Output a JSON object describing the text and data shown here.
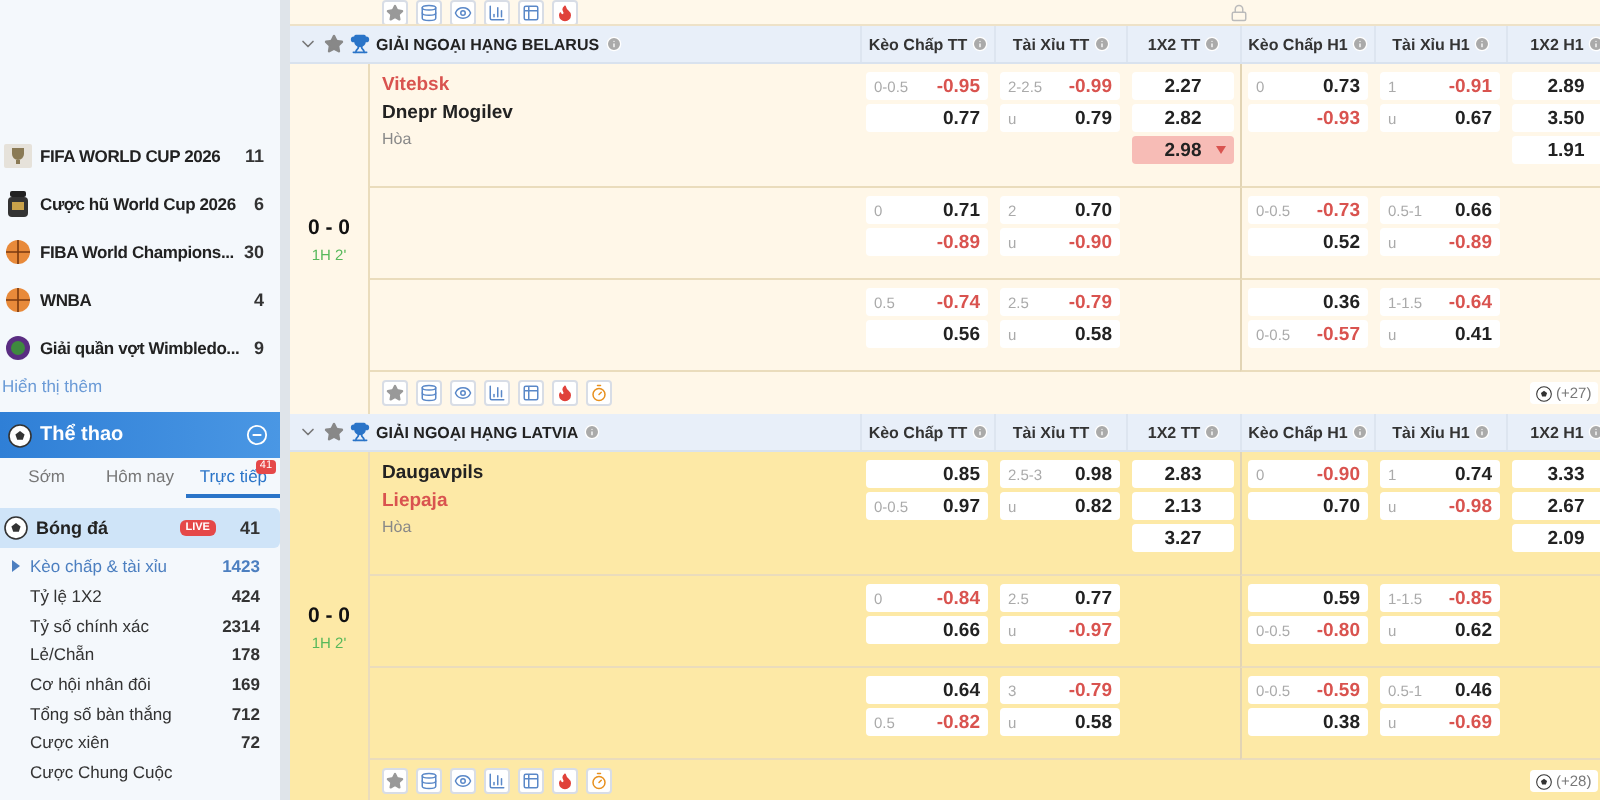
{
  "sidebar": {
    "leagues": [
      {
        "name": "FIFA WORLD CUP 2026",
        "count": "11",
        "kind": "trophy"
      },
      {
        "name": "Cược hũ World Cup 2026",
        "count": "6",
        "kind": "jar"
      },
      {
        "name": "FIBA World Champions...",
        "count": "30",
        "kind": "basketball"
      },
      {
        "name": "WNBA",
        "count": "4",
        "kind": "basketball"
      },
      {
        "name": "Giải quần vợt Wimbledo...",
        "count": "9",
        "kind": "tennis"
      }
    ],
    "show_more": "Hiển thị thêm",
    "sports_panel": {
      "title": "Thể thao",
      "tabs": [
        {
          "label": "Sớm",
          "selected": false
        },
        {
          "label": "Hôm nay",
          "selected": false
        },
        {
          "label": "Trực tiếp",
          "selected": true,
          "badge": "41"
        }
      ],
      "sports": [
        {
          "name": "Bóng đá",
          "live": "LIVE",
          "count": "41",
          "selected": true
        }
      ],
      "bet_types": [
        {
          "label": "Kèo chấp & tài xỉu",
          "count": "1423",
          "selected": true
        },
        {
          "label": "Tỷ lệ 1X2",
          "count": "424",
          "selected": false
        },
        {
          "label": "Tỷ số chính xác",
          "count": "2314",
          "selected": false
        },
        {
          "label": "Lẻ/Chẵn",
          "count": "178",
          "selected": false
        },
        {
          "label": "Cơ hội nhân đôi",
          "count": "169",
          "selected": false
        },
        {
          "label": "Tổng số bàn thắng",
          "count": "712",
          "selected": false
        },
        {
          "label": "Cược xiên",
          "count": "72",
          "selected": false
        },
        {
          "label": "Cược Chung Cuộc",
          "selected": false
        }
      ]
    }
  },
  "leagues": [
    {
      "name": "GIẢI NGOẠI HẠNG BELARUS",
      "highlighted": false,
      "columns": [
        {
          "label": "Kèo Chấp TT",
          "kind": "pair"
        },
        {
          "label": "Tài Xỉu TT",
          "kind": "pair"
        },
        {
          "label": "1X2 TT",
          "kind": "single"
        },
        {
          "label": "Kèo Chấp H1",
          "kind": "pair"
        },
        {
          "label": "Tài Xỉu H1",
          "kind": "pair"
        },
        {
          "label": "1X2 H1",
          "kind": "single"
        }
      ],
      "match": {
        "score": "0 - 0",
        "time": "1H 2'",
        "teams": [
          {
            "name": "Vitebsk",
            "favorite": true
          },
          {
            "name": "Dnepr Mogilev",
            "favorite": false
          }
        ],
        "draw": "Hòa",
        "more": "(+27)",
        "rows": [
          {
            "handicap_ft": [
              {
                "line": "0-0.5",
                "value": "-0.95"
              },
              {
                "value": "0.77"
              }
            ],
            "total_ft": [
              {
                "line": "2-2.5",
                "value": "-0.99"
              },
              {
                "line": "u",
                "value": "0.79"
              }
            ],
            "result_ft": [
              {
                "value": "2.27",
                "dropping": false
              },
              {
                "value": "2.82",
                "dropping": false
              },
              {
                "value": "2.98",
                "dropping": true
              }
            ],
            "handicap_h1": [
              {
                "line": "0",
                "value": "0.73"
              },
              {
                "value": "-0.93"
              }
            ],
            "total_h1": [
              {
                "line": "1",
                "value": "-0.91"
              },
              {
                "line": "u",
                "value": "0.67"
              }
            ],
            "result_h1": [
              {
                "value": "2.89",
                "dropping": false
              },
              {
                "value": "3.50",
                "dropping": false
              },
              {
                "value": "1.91",
                "dropping": false
              }
            ]
          },
          {
            "handicap_ft": [
              {
                "line": "0",
                "value": "0.71"
              },
              {
                "value": "-0.89"
              }
            ],
            "total_ft": [
              {
                "line": "2",
                "value": "0.70"
              },
              {
                "line": "u",
                "value": "-0.90"
              }
            ],
            "handicap_h1": [
              {
                "line": "0-0.5",
                "value": "-0.73"
              },
              {
                "value": "0.52"
              }
            ],
            "total_h1": [
              {
                "line": "0.5-1",
                "value": "0.66"
              },
              {
                "line": "u",
                "value": "-0.89"
              }
            ]
          },
          {
            "handicap_ft": [
              {
                "line": "0.5",
                "value": "-0.74"
              },
              {
                "value": "0.56"
              }
            ],
            "total_ft": [
              {
                "line": "2.5",
                "value": "-0.79"
              },
              {
                "line": "u",
                "value": "0.58"
              }
            ],
            "handicap_h1": [
              {
                "value": "0.36"
              },
              {
                "line": "0-0.5",
                "value": "-0.57"
              }
            ],
            "total_h1": [
              {
                "line": "1-1.5",
                "value": "-0.64"
              },
              {
                "line": "u",
                "value": "0.41"
              }
            ]
          }
        ]
      }
    },
    {
      "name": "GIẢI NGOẠI HẠNG LATVIA",
      "highlighted": true,
      "columns": [
        {
          "label": "Kèo Chấp TT",
          "kind": "pair"
        },
        {
          "label": "Tài Xỉu TT",
          "kind": "pair"
        },
        {
          "label": "1X2 TT",
          "kind": "single"
        },
        {
          "label": "Kèo Chấp H1",
          "kind": "pair"
        },
        {
          "label": "Tài Xỉu H1",
          "kind": "pair"
        },
        {
          "label": "1X2 H1",
          "kind": "single"
        }
      ],
      "match": {
        "score": "0 - 0",
        "time": "1H 2'",
        "teams": [
          {
            "name": "Daugavpils",
            "favorite": false
          },
          {
            "name": "Liepaja",
            "favorite": true
          }
        ],
        "draw": "Hòa",
        "more": "(+28)",
        "rows": [
          {
            "handicap_ft": [
              {
                "value": "0.85"
              },
              {
                "line": "0-0.5",
                "value": "0.97"
              }
            ],
            "total_ft": [
              {
                "line": "2.5-3",
                "value": "0.98"
              },
              {
                "line": "u",
                "value": "0.82"
              }
            ],
            "result_ft": [
              {
                "value": "2.83",
                "dropping": false
              },
              {
                "value": "2.13",
                "dropping": false
              },
              {
                "value": "3.27",
                "dropping": false
              }
            ],
            "handicap_h1": [
              {
                "line": "0",
                "value": "-0.90"
              },
              {
                "value": "0.70"
              }
            ],
            "total_h1": [
              {
                "line": "1",
                "value": "0.74"
              },
              {
                "line": "u",
                "value": "-0.98"
              }
            ],
            "result_h1": [
              {
                "value": "3.33",
                "dropping": false
              },
              {
                "value": "2.67",
                "dropping": false
              },
              {
                "value": "2.09",
                "dropping": false
              }
            ]
          },
          {
            "handicap_ft": [
              {
                "line": "0",
                "value": "-0.84"
              },
              {
                "value": "0.66"
              }
            ],
            "total_ft": [
              {
                "line": "2.5",
                "value": "0.77"
              },
              {
                "line": "u",
                "value": "-0.97"
              }
            ],
            "handicap_h1": [
              {
                "value": "0.59"
              },
              {
                "line": "0-0.5",
                "value": "-0.80"
              }
            ],
            "total_h1": [
              {
                "line": "1-1.5",
                "value": "-0.85"
              },
              {
                "line": "u",
                "value": "0.62"
              }
            ]
          },
          {
            "handicap_ft": [
              {
                "value": "0.64"
              },
              {
                "line": "0.5",
                "value": "-0.82"
              }
            ],
            "total_ft": [
              {
                "line": "3",
                "value": "-0.79"
              },
              {
                "line": "u",
                "value": "0.58"
              }
            ],
            "handicap_h1": [
              {
                "line": "0-0.5",
                "value": "-0.59"
              },
              {
                "value": "0.38"
              }
            ],
            "total_h1": [
              {
                "line": "0.5-1",
                "value": "0.46"
              },
              {
                "line": "u",
                "value": "-0.69"
              }
            ]
          }
        ]
      }
    }
  ]
}
